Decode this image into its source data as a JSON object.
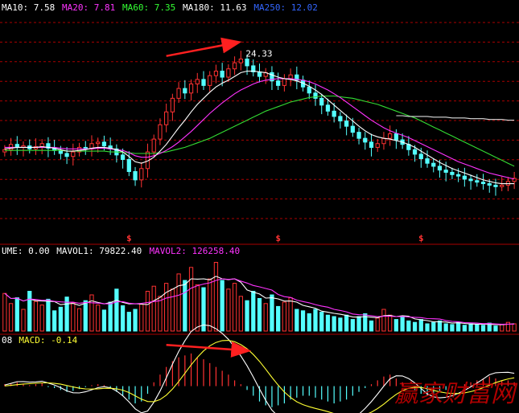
{
  "chart_data": [
    {
      "type": "candlestick",
      "panel": "price",
      "legend": [
        {
          "label": "MA10: 7.58",
          "color": "#ffffff"
        },
        {
          "label": "MA20: 7.81",
          "color": "#ff33ff"
        },
        {
          "label": "MA60: 7.35",
          "color": "#33ff33"
        },
        {
          "label": "MA180: 11.63",
          "color": "#ffffff"
        },
        {
          "label": "MA250: 12.02",
          "color": "#3366ff"
        }
      ],
      "annotations": [
        {
          "text": "24.33",
          "color": "#ffffff"
        },
        {
          "text": "$",
          "color": "#ff3333"
        },
        {
          "text": "$",
          "color": "#ff3333"
        },
        {
          "text": "$",
          "color": "#ff3333"
        }
      ],
      "ylim": [
        0,
        30
      ],
      "close": [
        12.1,
        12.8,
        12.4,
        12.6,
        12.2,
        12.5,
        12.9,
        12.3,
        12.0,
        11.6,
        11.2,
        11.8,
        12.4,
        12.2,
        12.9,
        13.1,
        12.6,
        12.2,
        11.4,
        10.8,
        9.2,
        8.1,
        9.6,
        11.8,
        13.5,
        15.4,
        17.1,
        18.9,
        20.2,
        19.6,
        20.8,
        21.4,
        20.6,
        21.9,
        22.5,
        21.7,
        22.8,
        23.6,
        24.1,
        23.2,
        22.4,
        21.8,
        22.3,
        21.2,
        20.6,
        21.5,
        22.0,
        21.3,
        20.4,
        19.6,
        18.9,
        18.0,
        17.2,
        16.5,
        15.9,
        15.2,
        14.4,
        13.6,
        13.1,
        12.4,
        12.9,
        13.6,
        14.2,
        13.4,
        12.8,
        12.1,
        11.5,
        10.9,
        10.3,
        9.9,
        9.4,
        9.1,
        8.8,
        8.6,
        8.2,
        8.0,
        7.8,
        7.6,
        7.4,
        7.2,
        7.4,
        7.9,
        8.3
      ],
      "ma10": [
        12.2,
        12.3,
        12.4,
        12.4,
        12.4,
        12.4,
        12.5,
        12.4,
        12.3,
        12.1,
        11.9,
        11.9,
        12.0,
        12.1,
        12.3,
        12.4,
        12.4,
        12.3,
        12.1,
        11.8,
        11.2,
        10.5,
        10.3,
        10.6,
        11.1,
        11.9,
        12.8,
        13.9,
        15.0,
        16.0,
        17.1,
        18.1,
        18.9,
        19.7,
        20.4,
        20.9,
        21.3,
        21.8,
        22.3,
        22.5,
        22.5,
        22.4,
        22.3,
        22.0,
        21.7,
        21.5,
        21.4,
        21.2,
        20.9,
        20.5,
        20.0,
        19.4,
        18.7,
        18.0,
        17.3,
        16.6,
        15.9,
        15.2,
        14.6,
        14.1,
        13.8,
        13.6,
        13.5,
        13.3,
        13.1,
        12.8,
        12.4,
        11.9,
        11.4,
        10.9,
        10.4,
        10.0,
        9.6,
        9.3,
        9.0,
        8.7,
        8.4,
        8.1,
        7.9,
        7.7,
        7.6,
        7.6,
        7.6
      ],
      "ma20": [
        12.4,
        12.4,
        12.4,
        12.4,
        12.4,
        12.4,
        12.4,
        12.4,
        12.4,
        12.3,
        12.2,
        12.2,
        12.2,
        12.2,
        12.2,
        12.3,
        12.3,
        12.2,
        12.1,
        12.0,
        11.7,
        11.3,
        11.1,
        11.1,
        11.3,
        11.6,
        12.0,
        12.5,
        13.1,
        13.8,
        14.5,
        15.3,
        16.1,
        16.9,
        17.6,
        18.3,
        18.9,
        19.5,
        20.0,
        20.4,
        20.8,
        21.1,
        21.3,
        21.4,
        21.5,
        21.5,
        21.5,
        21.4,
        21.3,
        21.1,
        20.8,
        20.4,
        20.0,
        19.5,
        19.0,
        18.4,
        17.8,
        17.2,
        16.6,
        16.0,
        15.5,
        15.0,
        14.6,
        14.3,
        14.0,
        13.7,
        13.3,
        12.9,
        12.5,
        12.1,
        11.7,
        11.3,
        10.9,
        10.5,
        10.2,
        9.9,
        9.6,
        9.3,
        9.0,
        8.8,
        8.6,
        8.4,
        8.2
      ],
      "ma60": [
        12.0,
        12.0,
        12.0,
        12.0,
        12.0,
        12.0,
        12.0,
        12.0,
        12.0,
        12.0,
        11.9,
        11.9,
        11.9,
        11.9,
        11.9,
        11.9,
        11.9,
        11.8,
        11.8,
        11.7,
        11.7,
        11.6,
        11.6,
        11.6,
        11.6,
        11.7,
        11.8,
        12.0,
        12.2,
        12.4,
        12.7,
        13.0,
        13.3,
        13.6,
        14.0,
        14.4,
        14.8,
        15.2,
        15.6,
        16.0,
        16.4,
        16.8,
        17.2,
        17.5,
        17.8,
        18.1,
        18.4,
        18.6,
        18.8,
        19.0,
        19.1,
        19.2,
        19.2,
        19.2,
        19.1,
        19.0,
        18.9,
        18.7,
        18.5,
        18.3,
        18.1,
        17.8,
        17.5,
        17.2,
        16.9,
        16.6,
        16.3,
        15.9,
        15.5,
        15.1,
        14.7,
        14.3,
        13.9,
        13.5,
        13.1,
        12.7,
        12.3,
        11.9,
        11.5,
        11.1,
        10.7,
        10.3,
        9.9
      ],
      "ma180": [
        null,
        null,
        null,
        null,
        null,
        null,
        null,
        null,
        null,
        null,
        null,
        null,
        null,
        null,
        null,
        null,
        null,
        null,
        null,
        null,
        null,
        null,
        null,
        null,
        null,
        null,
        null,
        null,
        null,
        null,
        null,
        null,
        null,
        null,
        null,
        null,
        null,
        null,
        null,
        null,
        null,
        null,
        null,
        null,
        null,
        null,
        null,
        null,
        null,
        null,
        null,
        null,
        null,
        null,
        null,
        null,
        null,
        null,
        null,
        null,
        null,
        null,
        null,
        16.6,
        16.6,
        16.5,
        16.5,
        16.5,
        16.5,
        16.4,
        16.4,
        16.4,
        16.3,
        16.3,
        16.3,
        16.2,
        16.2,
        16.2,
        16.1,
        16.1,
        16.1,
        16.0,
        16.0
      ]
    },
    {
      "type": "bar",
      "panel": "volume",
      "legend": [
        {
          "label": "UME: 0.00",
          "color": "#ffffff"
        },
        {
          "label": "MAVOL1: 79822.40",
          "color": "#ffffff"
        },
        {
          "label": "MAVOL2: 126258.40",
          "color": "#ff33ff"
        }
      ],
      "values": [
        52,
        38,
        46,
        30,
        55,
        41,
        36,
        44,
        28,
        33,
        47,
        39,
        31,
        42,
        50,
        36,
        29,
        40,
        58,
        35,
        26,
        30,
        37,
        55,
        62,
        48,
        66,
        58,
        79,
        70,
        88,
        64,
        60,
        72,
        95,
        70,
        58,
        66,
        48,
        42,
        55,
        45,
        38,
        50,
        34,
        40,
        46,
        30,
        28,
        24,
        30,
        26,
        22,
        20,
        18,
        22,
        16,
        20,
        24,
        14,
        18,
        30,
        22,
        16,
        20,
        14,
        12,
        16,
        10,
        12,
        14,
        10,
        9,
        12,
        8,
        10,
        9,
        8,
        11,
        7,
        9,
        12,
        10
      ],
      "ylim": [
        0,
        100
      ]
    },
    {
      "type": "bar",
      "panel": "macd",
      "legend": [
        {
          "label": "08",
          "color": "#ffffff"
        },
        {
          "label": "MACD: -0.14",
          "color": "#ffff33"
        }
      ],
      "values": [
        0.1,
        0.15,
        0.2,
        0.1,
        0.05,
        0.1,
        0.15,
        -0.05,
        -0.1,
        -0.2,
        -0.3,
        -0.25,
        -0.15,
        -0.05,
        0.05,
        0.1,
        0.05,
        -0.1,
        -0.3,
        -0.5,
        -0.7,
        -0.9,
        -0.8,
        -0.4,
        0.2,
        0.6,
        1.0,
        1.3,
        1.5,
        1.6,
        1.7,
        1.5,
        1.4,
        1.2,
        1.0,
        0.8,
        0.6,
        0.3,
        0.1,
        -0.2,
        -0.5,
        -0.8,
        -1.0,
        -1.1,
        -1.0,
        -0.9,
        -0.7,
        -0.6,
        -0.5,
        -0.5,
        -0.6,
        -0.7,
        -0.8,
        -0.9,
        -0.8,
        -0.7,
        -0.5,
        -0.3,
        -0.1,
        0.1,
        0.3,
        0.5,
        0.6,
        0.4,
        0.2,
        0.0,
        -0.2,
        -0.4,
        -0.5,
        -0.4,
        -0.3,
        -0.2,
        -0.1,
        0.0,
        0.1,
        0.2,
        0.3,
        0.4,
        0.5,
        0.4,
        0.3,
        0.3,
        0.2
      ],
      "ylim": [
        -1.4,
        2.2
      ]
    }
  ],
  "watermark": {
    "text": "赢家财富网",
    "color": "#cc0000"
  },
  "colors": {
    "up": "#ff3232",
    "down": "#54ffff",
    "grid": "#aa0000",
    "arrow": "#ff2020"
  }
}
